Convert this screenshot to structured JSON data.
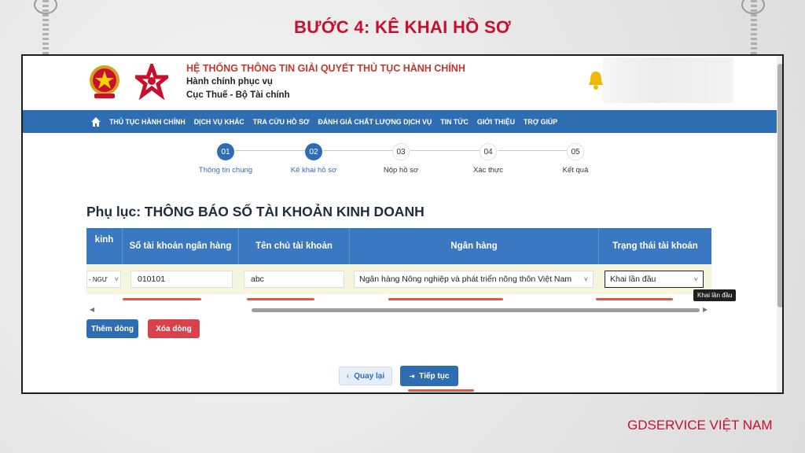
{
  "slide": {
    "title": "BƯỚC 4: KÊ KHAI HỒ SƠ",
    "brand": "GDSERVICE VIỆT NAM"
  },
  "header": {
    "system_title": "HỆ THỐNG THÔNG TIN GIẢI QUYẾT THỦ TỤC HÀNH CHÍNH",
    "subtitle_1": "Hành chính phục vụ",
    "subtitle_2": "Cục Thuế - Bộ Tài chính"
  },
  "nav": {
    "items": [
      {
        "label": "THỦ TỤC HÀNH CHÍNH"
      },
      {
        "label": "DỊCH VỤ KHÁC"
      },
      {
        "label": "TRA CỨU HỒ SƠ"
      },
      {
        "label": "ĐÁNH GIÁ CHẤT LƯỢNG DỊCH VỤ"
      },
      {
        "label": "TIN TỨC"
      },
      {
        "label": "GIỚI THIỆU"
      },
      {
        "label": "TRỢ GIÚP"
      }
    ]
  },
  "steps": [
    {
      "num": "01",
      "label": "Thông tin chung",
      "done": true
    },
    {
      "num": "02",
      "label": "Kê khai hồ sơ",
      "done": true
    },
    {
      "num": "03",
      "label": "Nộp hồ sơ",
      "done": false
    },
    {
      "num": "04",
      "label": "Xác thực",
      "done": false
    },
    {
      "num": "05",
      "label": "Kết quả",
      "done": false
    }
  ],
  "form": {
    "title": "Phụ lục: THÔNG BÁO SỐ TÀI KHOẢN KINH DOANH"
  },
  "table": {
    "headers": [
      "kinh",
      "Số tài khoản ngân hàng",
      "Tên chủ tài khoản",
      "Ngân hàng",
      "Trạng thái tài khoản"
    ],
    "row": {
      "col0": "- NGƯ",
      "account_number": "010101",
      "account_owner": "abc",
      "bank": "Ngân hàng Nông nghiệp và phát triển nông thôn Việt Nam",
      "status": "Khai lần đầu"
    },
    "tooltip": "Khai lần đầu"
  },
  "buttons": {
    "add_row": "Thêm dòng",
    "delete_row": "Xóa dòng",
    "back": "Quay lại",
    "next": "Tiếp tục"
  },
  "colors": {
    "primary": "#2f6db3",
    "danger": "#d9424a",
    "accent_red": "#c8102e",
    "row_bg": "#f6f6df"
  }
}
